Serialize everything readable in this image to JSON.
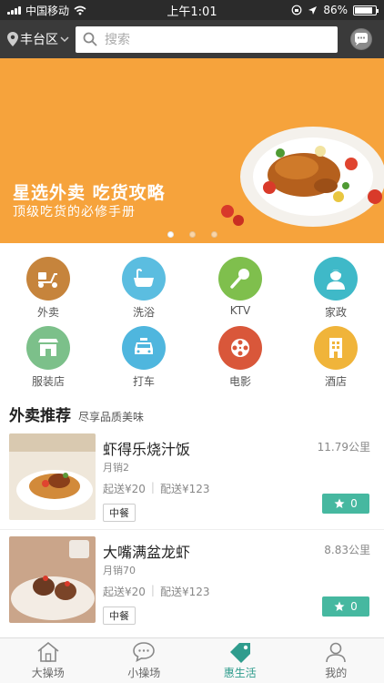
{
  "status_bar": {
    "carrier": "中国移动",
    "time": "上午1:01",
    "battery": "86%",
    "battery_level": 0.86
  },
  "header": {
    "location": "丰台区",
    "search_placeholder": "搜索"
  },
  "banner": {
    "title": "星选外卖 吃货攻略",
    "subtitle": "顶级吃货的必修手册",
    "slide_count": 3,
    "active_slide": 1
  },
  "categories": [
    {
      "label": "外卖",
      "icon": "scooter-icon",
      "color": "#c6843c"
    },
    {
      "label": "洗浴",
      "icon": "bathtub-icon",
      "color": "#5bbde0"
    },
    {
      "label": "KTV",
      "icon": "microphone-icon",
      "color": "#7fbf4d"
    },
    {
      "label": "家政",
      "icon": "housekeeper-icon",
      "color": "#3fb9c8"
    },
    {
      "label": "服装店",
      "icon": "store-icon",
      "color": "#7cc08a"
    },
    {
      "label": "打车",
      "icon": "taxi-icon",
      "color": "#4fb6de"
    },
    {
      "label": "电影",
      "icon": "film-reel-icon",
      "color": "#d9573a"
    },
    {
      "label": "酒店",
      "icon": "hotel-icon",
      "color": "#f0b43a"
    }
  ],
  "section": {
    "title": "外卖推荐",
    "subtitle": "尽享品质美味"
  },
  "restaurants": [
    {
      "name": "虾得乐烧汁饭",
      "distance": "11.79公里",
      "sales": "月销2",
      "min_order": "起送¥20",
      "delivery": "配送¥123",
      "tag": "中餐",
      "favorites": "0"
    },
    {
      "name": "大嘴满盆龙虾",
      "distance": "8.83公里",
      "sales": "月销70",
      "min_order": "起送¥20",
      "delivery": "配送¥123",
      "tag": "中餐",
      "favorites": "0"
    }
  ],
  "tabs": [
    {
      "label": "大操场",
      "icon": "home-icon",
      "active": false
    },
    {
      "label": "小操场",
      "icon": "chat-bubble-icon",
      "active": false
    },
    {
      "label": "惠生活",
      "icon": "price-tag-icon",
      "active": true
    },
    {
      "label": "我的",
      "icon": "user-icon",
      "active": false
    }
  ],
  "colors": {
    "accent": "#2f9c8d",
    "banner_bg": "#f6a33c",
    "header_bg": "#3a3a3a",
    "fav_button": "#46b8a0"
  }
}
